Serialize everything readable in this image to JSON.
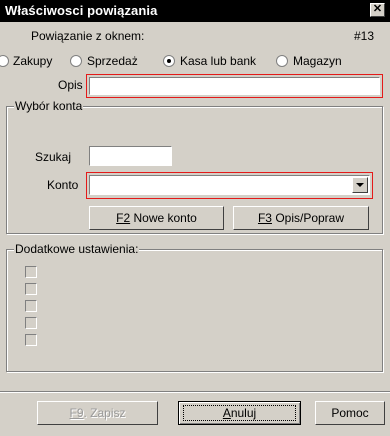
{
  "window": {
    "title": "Właściwosci powiązania"
  },
  "header": {
    "label": "Powiązanie z oknem:",
    "window_number": "#13"
  },
  "radios": [
    {
      "label": "Zakupy",
      "checked": false
    },
    {
      "label": "Sprzedaż",
      "checked": false
    },
    {
      "label": "Kasa lub bank",
      "checked": true
    },
    {
      "label": "Magazyn",
      "checked": false
    }
  ],
  "opis": {
    "label": "Opis",
    "value": ""
  },
  "konto_group": {
    "legend": "Wybór konta",
    "search_label": "Szukaj",
    "search_value": "",
    "konto_label": "Konto",
    "konto_value": "",
    "new_account": {
      "key": "F2",
      "label": " Nowe konto"
    },
    "edit_description": {
      "key": "F3",
      "label": " Opis/Popraw"
    }
  },
  "extra_group": {
    "legend": "Dodatkowe ustawienia:",
    "checkboxes": [
      false,
      false,
      false,
      false,
      false
    ]
  },
  "footer": {
    "save": {
      "key": "F9",
      "label": ". Zapisz",
      "enabled": false
    },
    "cancel": {
      "accel": "A",
      "rest": "nuluj"
    },
    "help": "Pomoc"
  },
  "colors": {
    "highlight": "#e41a1a",
    "face": "#d4d0c8",
    "titlebar": "#000000"
  }
}
